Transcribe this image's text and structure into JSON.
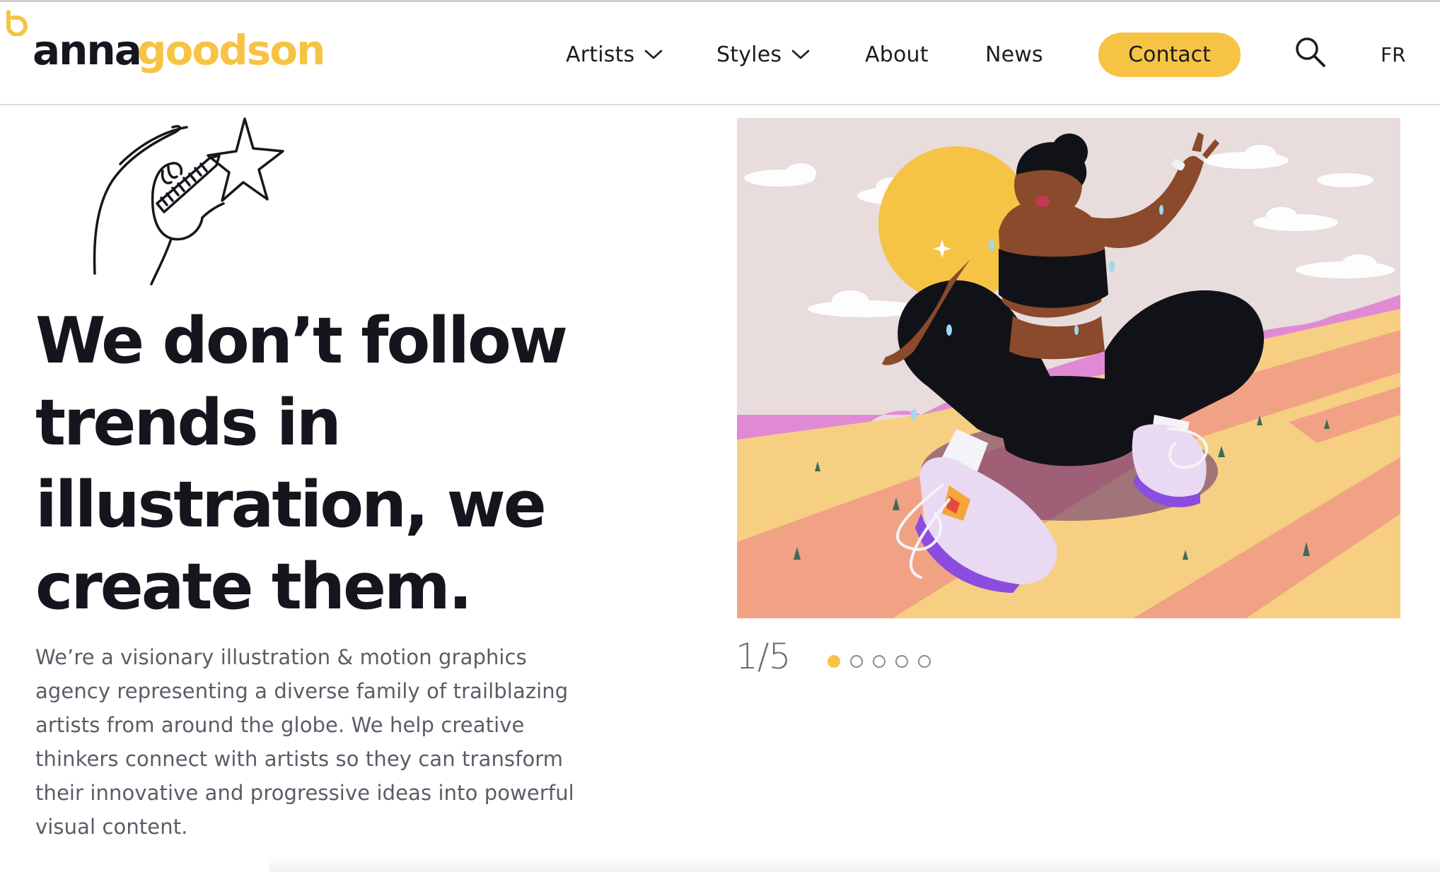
{
  "brand": {
    "logo_text_dark": "anna",
    "logo_text_accent": "goodson",
    "accent_color": "#f6c344",
    "dark_color": "#16161e"
  },
  "nav": {
    "artists": "Artists",
    "styles": "Styles",
    "about": "About",
    "news": "News",
    "contact": "Contact",
    "language": "FR",
    "search_icon": "search-icon",
    "dropdown_icon": "chevron-down-icon"
  },
  "hero": {
    "headline_lines": [
      "We don’t follow",
      "trends in",
      "illustration, we",
      "create them."
    ],
    "intro": "We’re a visionary illustration & motion graphics agency representing a diverse family of trailblazing artists from around the globe. We help creative thinkers connect with artists so they can transform their innovative and progressive ideas into powerful visual content."
  },
  "slider": {
    "counter": "1/5",
    "current": 1,
    "total": 5
  }
}
